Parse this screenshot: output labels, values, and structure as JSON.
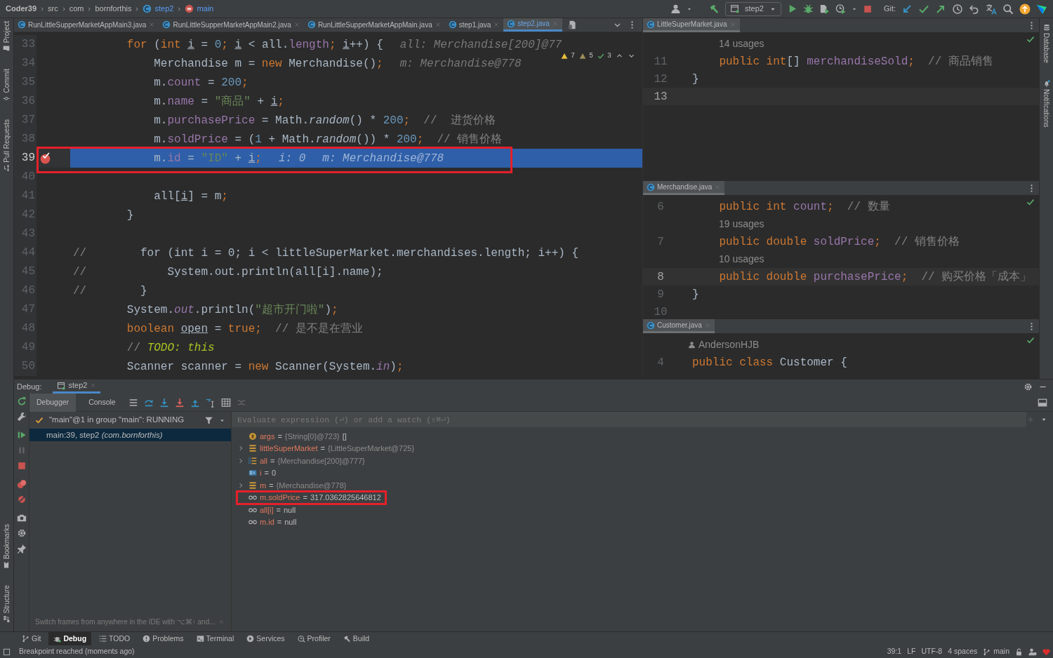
{
  "breadcrumbs": [
    {
      "text": "Coder39",
      "kind": "project"
    },
    {
      "text": "src",
      "kind": "folder"
    },
    {
      "text": "com",
      "kind": "folder"
    },
    {
      "text": "bornforthis",
      "kind": "folder"
    },
    {
      "text": "step2",
      "kind": "class"
    },
    {
      "text": "main",
      "kind": "method"
    }
  ],
  "toolbar": {
    "run_config": "step2",
    "git_label": "Git:"
  },
  "left_stripe": {
    "top": [
      "Project",
      "Commit",
      "Pull Requests"
    ],
    "bottom": [
      "Bookmarks",
      "Structure"
    ]
  },
  "right_stripe": [
    "Database",
    "Notifications"
  ],
  "editor": {
    "tabs": [
      {
        "label": "RunLittleSupperMarketAppMain3.java",
        "selected": false
      },
      {
        "label": "RunLittleSupperMarketAppMain2.java",
        "selected": false
      },
      {
        "label": "RunLittleSupperMarketAppMain.java",
        "selected": false
      },
      {
        "label": "step1.java",
        "selected": false
      },
      {
        "label": "step2.java",
        "selected": true
      }
    ],
    "inspections": [
      {
        "kind": "warning",
        "count": "7"
      },
      {
        "kind": "weak",
        "count": "5"
      },
      {
        "kind": "ok",
        "count": "3"
      }
    ],
    "lines": [
      {
        "num": "33",
        "current": false,
        "breakpoint": false,
        "boxed": false,
        "tokens": [
          {
            "text": "        for",
            "kind": "keyword"
          },
          {
            "text": " (",
            "kind": "plain"
          },
          {
            "text": "int ",
            "kind": "keyword"
          },
          {
            "text": "i",
            "kind": "local"
          },
          {
            "text": " = ",
            "kind": "plain"
          },
          {
            "text": "0",
            "kind": "number"
          },
          {
            "text": "; ",
            "kind": "keyword"
          },
          {
            "text": "i",
            "kind": "local"
          },
          {
            "text": " < all.",
            "kind": "plain"
          },
          {
            "text": "length",
            "kind": "field"
          },
          {
            "text": "; ",
            "kind": "keyword"
          },
          {
            "text": "i",
            "kind": "local"
          },
          {
            "text": "++) {",
            "kind": "plain"
          }
        ],
        "hints": [
          "all: Merchandise[200]@77"
        ]
      },
      {
        "num": "34",
        "current": false,
        "breakpoint": false,
        "boxed": false,
        "tokens": [
          {
            "text": "            Merchandise m = ",
            "kind": "plain"
          },
          {
            "text": "new",
            "kind": "keyword"
          },
          {
            "text": " Merchandise()",
            "kind": "plain"
          },
          {
            "text": ";",
            "kind": "keyword"
          }
        ],
        "hints": [
          "m: Merchandise@778"
        ]
      },
      {
        "num": "35",
        "current": false,
        "breakpoint": false,
        "boxed": false,
        "tokens": [
          {
            "text": "            m.",
            "kind": "plain"
          },
          {
            "text": "count",
            "kind": "field"
          },
          {
            "text": " = ",
            "kind": "plain"
          },
          {
            "text": "200",
            "kind": "number"
          },
          {
            "text": ";",
            "kind": "keyword"
          }
        ]
      },
      {
        "num": "36",
        "current": false,
        "breakpoint": false,
        "boxed": false,
        "tokens": [
          {
            "text": "            m.",
            "kind": "plain"
          },
          {
            "text": "name",
            "kind": "field"
          },
          {
            "text": " = ",
            "kind": "plain"
          },
          {
            "text": "\"商品\"",
            "kind": "string"
          },
          {
            "text": " + ",
            "kind": "plain"
          },
          {
            "text": "i",
            "kind": "local"
          },
          {
            "text": ";",
            "kind": "keyword"
          }
        ]
      },
      {
        "num": "37",
        "current": false,
        "breakpoint": false,
        "boxed": false,
        "tokens": [
          {
            "text": "            m.",
            "kind": "plain"
          },
          {
            "text": "purchasePrice",
            "kind": "field"
          },
          {
            "text": " = Math.",
            "kind": "plain"
          },
          {
            "text": "random",
            "kind": "italic"
          },
          {
            "text": "() * ",
            "kind": "plain"
          },
          {
            "text": "200",
            "kind": "number"
          },
          {
            "text": ";",
            "kind": "keyword"
          },
          {
            "text": "  //  进货价格",
            "kind": "comment"
          }
        ]
      },
      {
        "num": "38",
        "current": false,
        "breakpoint": false,
        "boxed": false,
        "tokens": [
          {
            "text": "            m.",
            "kind": "plain"
          },
          {
            "text": "soldPrice",
            "kind": "field"
          },
          {
            "text": " = (",
            "kind": "plain"
          },
          {
            "text": "1",
            "kind": "number"
          },
          {
            "text": " + Math.",
            "kind": "plain"
          },
          {
            "text": "random",
            "kind": "italic"
          },
          {
            "text": "()) * ",
            "kind": "plain"
          },
          {
            "text": "200",
            "kind": "number"
          },
          {
            "text": ";",
            "kind": "keyword"
          },
          {
            "text": "  // 销售价格",
            "kind": "comment"
          }
        ]
      },
      {
        "num": "39",
        "current": true,
        "breakpoint": true,
        "boxed": true,
        "tokens": [
          {
            "text": "            m.",
            "kind": "plain"
          },
          {
            "text": "id",
            "kind": "field"
          },
          {
            "text": " = ",
            "kind": "plain"
          },
          {
            "text": "\"ID\"",
            "kind": "string"
          },
          {
            "text": " + ",
            "kind": "plain"
          },
          {
            "text": "i",
            "kind": "local"
          },
          {
            "text": ";",
            "kind": "keyword"
          }
        ],
        "hints": [
          "i: 0",
          "m: Merchandise@778"
        ]
      },
      {
        "num": "40",
        "current": false,
        "breakpoint": false,
        "boxed": false
      },
      {
        "num": "41",
        "current": false,
        "breakpoint": false,
        "boxed": false,
        "tokens": [
          {
            "text": "            all[",
            "kind": "plain"
          },
          {
            "text": "i",
            "kind": "local"
          },
          {
            "text": "] = m",
            "kind": "plain"
          },
          {
            "text": ";",
            "kind": "keyword"
          }
        ]
      },
      {
        "num": "42",
        "current": false,
        "breakpoint": false,
        "boxed": false,
        "tokens": [
          {
            "text": "        }",
            "kind": "plain"
          }
        ]
      },
      {
        "num": "43",
        "current": false,
        "breakpoint": false,
        "boxed": false
      },
      {
        "num": "44",
        "current": false,
        "breakpoint": false,
        "boxed": false,
        "tokens": [
          {
            "text": "//",
            "kind": "comment"
          },
          {
            "text": "        for (int i = 0; i < littleSuperMarket.merchandises.length; i++) {",
            "kind": "disabled"
          }
        ]
      },
      {
        "num": "45",
        "current": false,
        "breakpoint": false,
        "boxed": false,
        "tokens": [
          {
            "text": "//",
            "kind": "comment"
          },
          {
            "text": "            System.out.println(all[i].name);",
            "kind": "disabled"
          }
        ]
      },
      {
        "num": "46",
        "current": false,
        "breakpoint": false,
        "boxed": false,
        "tokens": [
          {
            "text": "//",
            "kind": "comment"
          },
          {
            "text": "        }",
            "kind": "disabled"
          }
        ]
      },
      {
        "num": "47",
        "current": false,
        "breakpoint": false,
        "boxed": false,
        "tokens": [
          {
            "text": "        System.",
            "kind": "plain"
          },
          {
            "text": "out",
            "kind": "static"
          },
          {
            "text": ".println(",
            "kind": "plain"
          },
          {
            "text": "\"超市开门啦\"",
            "kind": "string"
          },
          {
            "text": ")",
            "kind": "plain"
          },
          {
            "text": ";",
            "kind": "keyword"
          }
        ]
      },
      {
        "num": "48",
        "current": false,
        "breakpoint": false,
        "boxed": false,
        "tokens": [
          {
            "text": "        boolean ",
            "kind": "keyword"
          },
          {
            "text": "open",
            "kind": "local"
          },
          {
            "text": " = ",
            "kind": "plain"
          },
          {
            "text": "true",
            "kind": "keyword"
          },
          {
            "text": ";",
            "kind": "keyword"
          },
          {
            "text": "  // 是不是在营业",
            "kind": "comment"
          }
        ]
      },
      {
        "num": "49",
        "current": false,
        "breakpoint": false,
        "boxed": false,
        "tokens": [
          {
            "text": "        // ",
            "kind": "comment"
          },
          {
            "text": "TODO: this",
            "kind": "todo"
          }
        ]
      },
      {
        "num": "50",
        "current": false,
        "breakpoint": false,
        "boxed": false,
        "tokens": [
          {
            "text": "        Scanner scanner = ",
            "kind": "plain"
          },
          {
            "text": "new",
            "kind": "keyword"
          },
          {
            "text": " Scanner(System.",
            "kind": "plain"
          },
          {
            "text": "in",
            "kind": "static"
          },
          {
            "text": ")",
            "kind": "plain"
          },
          {
            "text": ";",
            "kind": "keyword"
          }
        ]
      }
    ]
  },
  "panes": [
    {
      "tab": "LittleSuperMarket.java",
      "rows": [
        {
          "kind": "usages",
          "text": "14 usages"
        },
        {
          "kind": "code",
          "num": "11",
          "current": false,
          "tokens": [
            {
              "text": "    public int",
              "kind": "keyword"
            },
            {
              "text": "[] ",
              "kind": "plain"
            },
            {
              "text": "merchandiseSold",
              "kind": "field"
            },
            {
              "text": ";",
              "kind": "keyword"
            },
            {
              "text": "  // 商品销售",
              "kind": "comment"
            }
          ]
        },
        {
          "kind": "code",
          "num": "12",
          "current": false,
          "tokens": [
            {
              "text": "}",
              "kind": "plain"
            }
          ]
        },
        {
          "kind": "code",
          "num": "13",
          "current": true
        }
      ]
    },
    {
      "tab": "Merchandise.java",
      "rows": [
        {
          "kind": "code",
          "num": "6",
          "current": false,
          "tokens": [
            {
              "text": "    public int ",
              "kind": "keyword"
            },
            {
              "text": "count",
              "kind": "field"
            },
            {
              "text": ";",
              "kind": "keyword"
            },
            {
              "text": "  // 数量",
              "kind": "comment"
            }
          ]
        },
        {
          "kind": "usages",
          "text": "19 usages"
        },
        {
          "kind": "code",
          "num": "7",
          "current": false,
          "tokens": [
            {
              "text": "    public double ",
              "kind": "keyword"
            },
            {
              "text": "soldPrice",
              "kind": "field"
            },
            {
              "text": ";",
              "kind": "keyword"
            },
            {
              "text": "  // 销售价格",
              "kind": "comment"
            }
          ]
        },
        {
          "kind": "usages",
          "text": "10 usages"
        },
        {
          "kind": "code",
          "num": "8",
          "current": true,
          "tokens": [
            {
              "text": "    public double ",
              "kind": "keyword"
            },
            {
              "text": "purchasePrice",
              "kind": "field"
            },
            {
              "text": ";",
              "kind": "keyword"
            },
            {
              "text": "  // 购买价格「成本」",
              "kind": "comment"
            }
          ]
        },
        {
          "kind": "code",
          "num": "9",
          "current": false,
          "tokens": [
            {
              "text": "}",
              "kind": "plain"
            }
          ]
        },
        {
          "kind": "code",
          "num": "10",
          "current": false
        }
      ]
    },
    {
      "tab": "Customer.java",
      "rows": [
        {
          "kind": "author",
          "text": "AndersonHJB"
        },
        {
          "kind": "code",
          "num": "4",
          "current": false,
          "tokens": [
            {
              "text": "public class ",
              "kind": "keyword"
            },
            {
              "text": "Customer {",
              "kind": "plain"
            }
          ]
        }
      ]
    }
  ],
  "debug": {
    "title": "Debug:",
    "session_tab": "step2",
    "tabs": [
      {
        "label": "Debugger",
        "selected": true
      },
      {
        "label": "Console",
        "selected": false
      }
    ],
    "thread": "\"main\"@1 in group \"main\": RUNNING",
    "frames": [
      {
        "text": "main:39, step2 *(com.bornforthis)*",
        "selected": true
      }
    ],
    "hint": "Switch frames from anywhere in the IDE with ⌥⌘↑ and...",
    "evaluate_placeholder": "Evaluate expression (⏎) or add a watch (⇧⌘⏎)",
    "variables": [
      {
        "kind": "param",
        "name": "args",
        "op": "=",
        "ref": "{String[0]@723}",
        "text": "[]",
        "expandable": false,
        "boxed": false
      },
      {
        "kind": "field",
        "name": "littleSuperMarket",
        "op": "=",
        "ref": "{LittleSuperMarket@725}",
        "expandable": true,
        "boxed": false
      },
      {
        "kind": "array",
        "name": "all",
        "op": "=",
        "ref": "{Merchandise[200]@777}",
        "expandable": true,
        "boxed": false
      },
      {
        "kind": "primitive",
        "name": "i",
        "op": "=",
        "text": "0",
        "expandable": false,
        "boxed": false
      },
      {
        "kind": "field",
        "name": "m",
        "op": "=",
        "ref": "{Merchandise@778}",
        "expandable": true,
        "boxed": false
      },
      {
        "kind": "watch",
        "name": "m.soldPrice",
        "op": "=",
        "text": "317.0362825646812",
        "expandable": false,
        "boxed": true
      },
      {
        "kind": "watch",
        "name": "all[i]",
        "op": "=",
        "text": "null",
        "expandable": false,
        "boxed": false
      },
      {
        "kind": "watch",
        "name": "m.id",
        "op": "=",
        "text": "null",
        "expandable": false,
        "boxed": false
      }
    ]
  },
  "tool_windows": [
    {
      "label": "Git",
      "kind": "git",
      "selected": false
    },
    {
      "label": "Debug",
      "kind": "debug",
      "selected": true
    },
    {
      "label": "TODO",
      "kind": "todo",
      "selected": false
    },
    {
      "label": "Problems",
      "kind": "problems",
      "selected": false
    },
    {
      "label": "Terminal",
      "kind": "terminal",
      "selected": false
    },
    {
      "label": "Services",
      "kind": "services",
      "selected": false
    },
    {
      "label": "Profiler",
      "kind": "profiler",
      "selected": false
    },
    {
      "label": "Build",
      "kind": "build",
      "selected": false
    }
  ],
  "status_bar": {
    "message": "Breakpoint reached (moments ago)",
    "items": [
      {
        "text": "39:1",
        "kind": "plain"
      },
      {
        "text": "LF",
        "kind": "plain"
      },
      {
        "text": "UTF-8",
        "kind": "plain"
      },
      {
        "text": "4 spaces",
        "kind": "plain"
      },
      {
        "text": "main",
        "kind": "branch"
      }
    ]
  }
}
